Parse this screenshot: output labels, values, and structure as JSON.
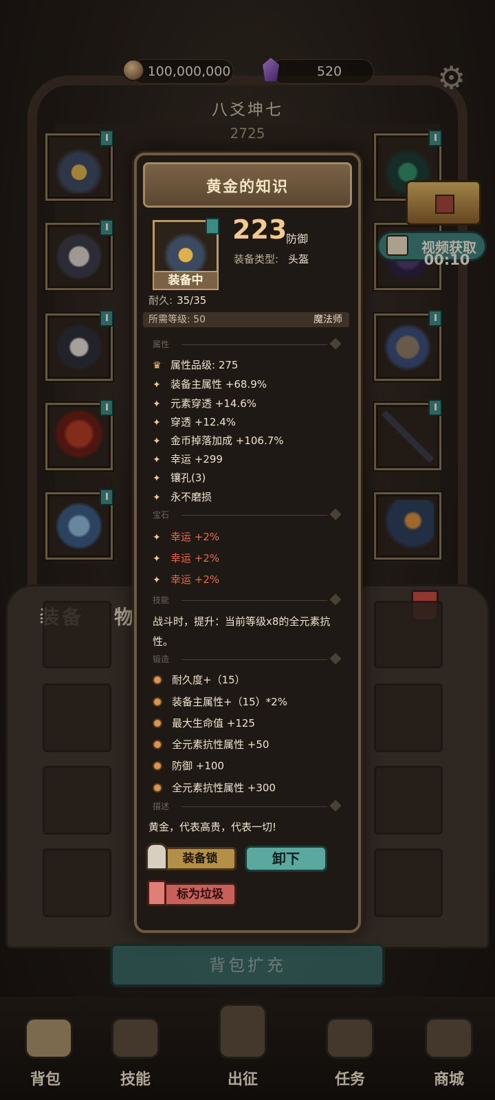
{
  "currency": {
    "coins": "100,000,000",
    "gems": "520"
  },
  "hero": {
    "name": "八爻坤七",
    "power": "2725"
  },
  "video_reward": {
    "label": "视频获取",
    "timer": "00:10"
  },
  "bag": {
    "tab_equipment": "装备",
    "tab_items": "物品",
    "expand_label": "背包扩充"
  },
  "nav": [
    {
      "label": "背包"
    },
    {
      "label": "技能"
    },
    {
      "label": "出征"
    },
    {
      "label": "任务"
    },
    {
      "label": "商城"
    }
  ],
  "item": {
    "name": "黄金的知识",
    "equipped_label": "装备中",
    "main_stat_value": "223",
    "main_stat_unit": "防御",
    "type_label": "装备类型:",
    "type_value": "头盔",
    "durability_label": "耐久:",
    "durability_value": "35/35",
    "req_level_label": "所需等级: 50",
    "req_class": "魔法师",
    "sections": {
      "attributes": "属性",
      "gems": "宝石",
      "skill": "技能",
      "forge": "锻造",
      "description": "描述"
    },
    "quality_label": "属性品级: 275",
    "attributes": [
      "装备主属性 +68.9%",
      "元素穿透 +14.6%",
      "穿透 +12.4%",
      "金币掉落加成 +106.7%",
      "幸运 +299",
      "镶孔(3)",
      "永不磨损"
    ],
    "gems": [
      {
        "name": "幸运",
        "bonus": "+2%"
      },
      {
        "name": "幸运",
        "bonus": "+2%"
      },
      {
        "name": "幸运",
        "bonus": "+2%"
      }
    ],
    "skill_text": "战斗时，提升：当前等级x8的全元素抗性。",
    "forge": [
      "耐久度+（15）",
      "装备主属性+（15）*2%",
      "最大生命值 +125",
      "全元素抗性属性 +50",
      "防御 +100",
      "全元素抗性属性 +300"
    ],
    "description": "黄金，代表高贵，代表一切!",
    "buttons": {
      "lock": "装备锁",
      "unequip": "卸下",
      "mark_trash": "标为垃圾"
    }
  },
  "colors": {
    "accent_gold": "#f2c98e",
    "gem_red": "#e56c4a",
    "teal": "#3d7f79"
  }
}
